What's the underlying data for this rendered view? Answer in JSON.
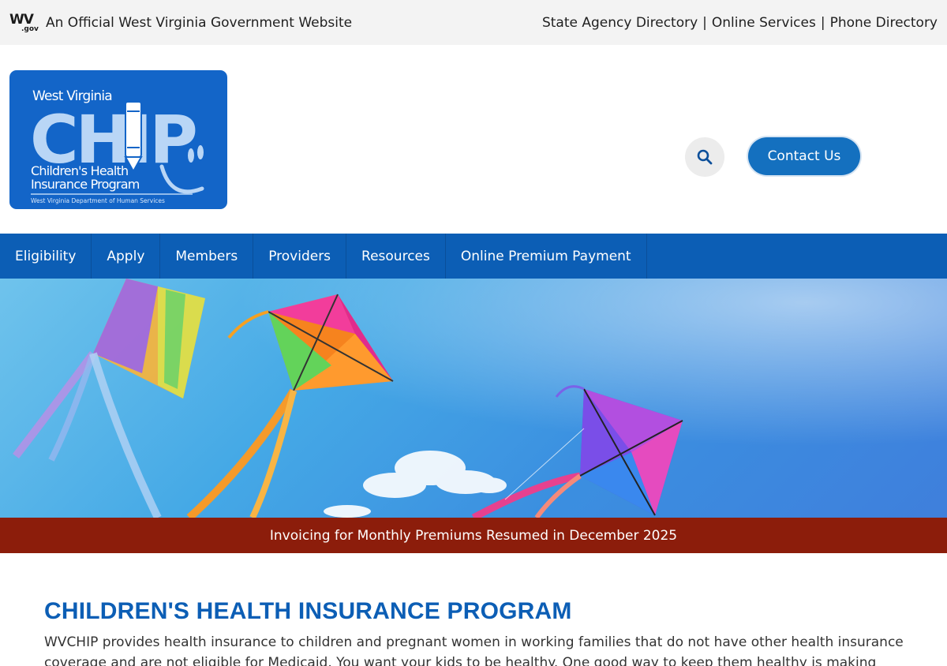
{
  "gov_bar": {
    "logo_main": "WV",
    "logo_sub": ".gov",
    "official_text": "An Official West Virginia Government Website",
    "links": [
      "State Agency Directory",
      "Online Services",
      "Phone Directory"
    ],
    "separator": "|"
  },
  "logo": {
    "state": "West Virginia",
    "acronym": "CHIP",
    "line1": "Children's Health",
    "line2": "Insurance Program",
    "department": "West Virginia Department of Human Services"
  },
  "header": {
    "search_icon": "search-icon",
    "contact_label": "Contact Us"
  },
  "nav": {
    "items": [
      "Eligibility",
      "Apply",
      "Members",
      "Providers",
      "Resources",
      "Online Premium Payment"
    ]
  },
  "alert": {
    "text": "Invoicing for Monthly Premiums Resumed in December 2025"
  },
  "content": {
    "title": "CHILDREN'S HEALTH INSURANCE PROGRAM",
    "intro": "WVCHIP provides health insurance to children and pregnant women in working families that do not have other health insurance coverage and are not eligible for Medicaid. You want your kids to be healthy. One good way to keep them healthy is making sure they"
  },
  "colors": {
    "brand_blue": "#0c5eb5",
    "logo_blue": "#1365c8",
    "button_blue": "#1470bf",
    "alert_red": "#8c1d0b",
    "gov_bar_bg": "#f3f3f3"
  }
}
